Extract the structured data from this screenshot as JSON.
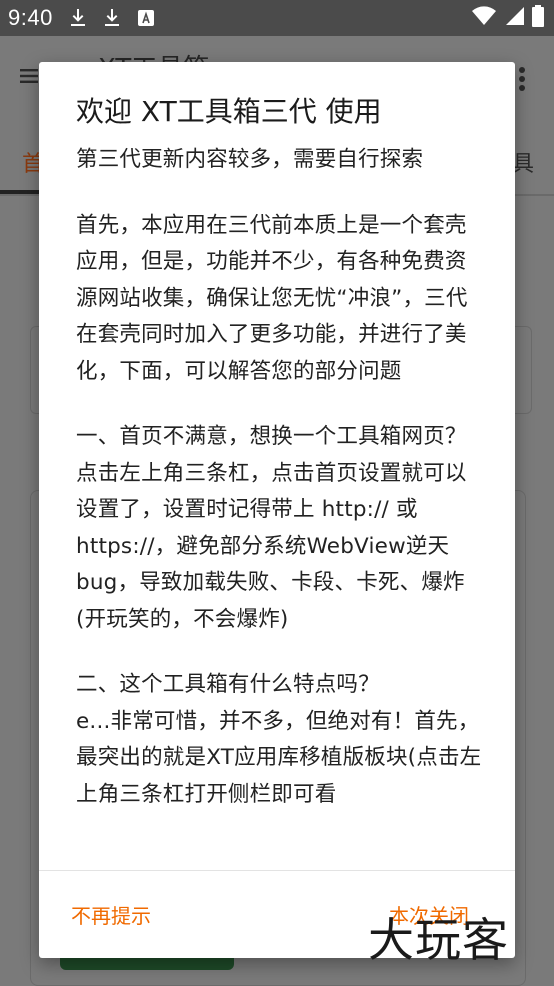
{
  "status_bar": {
    "time": "9:40",
    "left_icons": [
      "download-icon",
      "download-icon",
      "font-download-icon"
    ],
    "right_icons": [
      "wifi-icon",
      "signal-icon",
      "battery-icon"
    ]
  },
  "background_app": {
    "title": "XT工具箱",
    "tab_left_partial": "首",
    "tab_right_partial": "具"
  },
  "dialog": {
    "title": "欢迎 XT工具箱三代 使用",
    "paragraphs": [
      "第三代更新内容较多，需要自行探索",
      "首先，本应用在三代前本质上是一个套壳应用，但是，功能并不少，有各种免费资源网站收集，确保让您无忧“冲浪”，三代在套壳同时加入了更多功能，并进行了美化，下面，可以解答您的部分问题",
      "一、首页不满意，想换一个工具箱网页？\n点击左上角三条杠，点击首页设置就可以设置了，设置时记得带上 http:// 或https://，避免部分系统WebView逆天bug，导致加载失败、卡段、卡死、爆炸(开玩笑的，不会爆炸)",
      "二、这个工具箱有什么特点吗？\ne...非常可惜，并不多，但绝对有！首先，最突出的就是XT应用库移植版板块(点击左上角三条杠打开侧栏即可看"
    ],
    "button_dont_remind": "不再提示",
    "button_close_once": "本次关闭"
  },
  "watermark": "大玩客",
  "colors": {
    "accent": "#f06a00",
    "status_bar": "#4b4b4b",
    "scrim": "#7a7a7a"
  }
}
